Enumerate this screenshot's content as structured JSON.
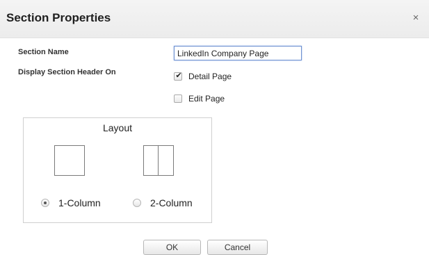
{
  "dialog": {
    "title": "Section Properties",
    "close_glyph": "×",
    "close_icon": "close-icon"
  },
  "form": {
    "section_name_label": "Section Name",
    "section_name_value": "LinkedIn Company Page",
    "display_header_label": "Display Section Header On",
    "detail_page": {
      "label": "Detail Page",
      "checked": true
    },
    "edit_page": {
      "label": "Edit Page",
      "checked": false
    }
  },
  "layout": {
    "title": "Layout",
    "options": [
      {
        "label": "1-Column",
        "selected": true,
        "icon": "one-column-icon"
      },
      {
        "label": "2-Column",
        "selected": false,
        "icon": "two-column-icon"
      }
    ]
  },
  "buttons": {
    "ok": "OK",
    "cancel": "Cancel"
  },
  "colors": {
    "input_focus_border": "#6d8fd0",
    "header_bg": "#f4f4f4"
  }
}
